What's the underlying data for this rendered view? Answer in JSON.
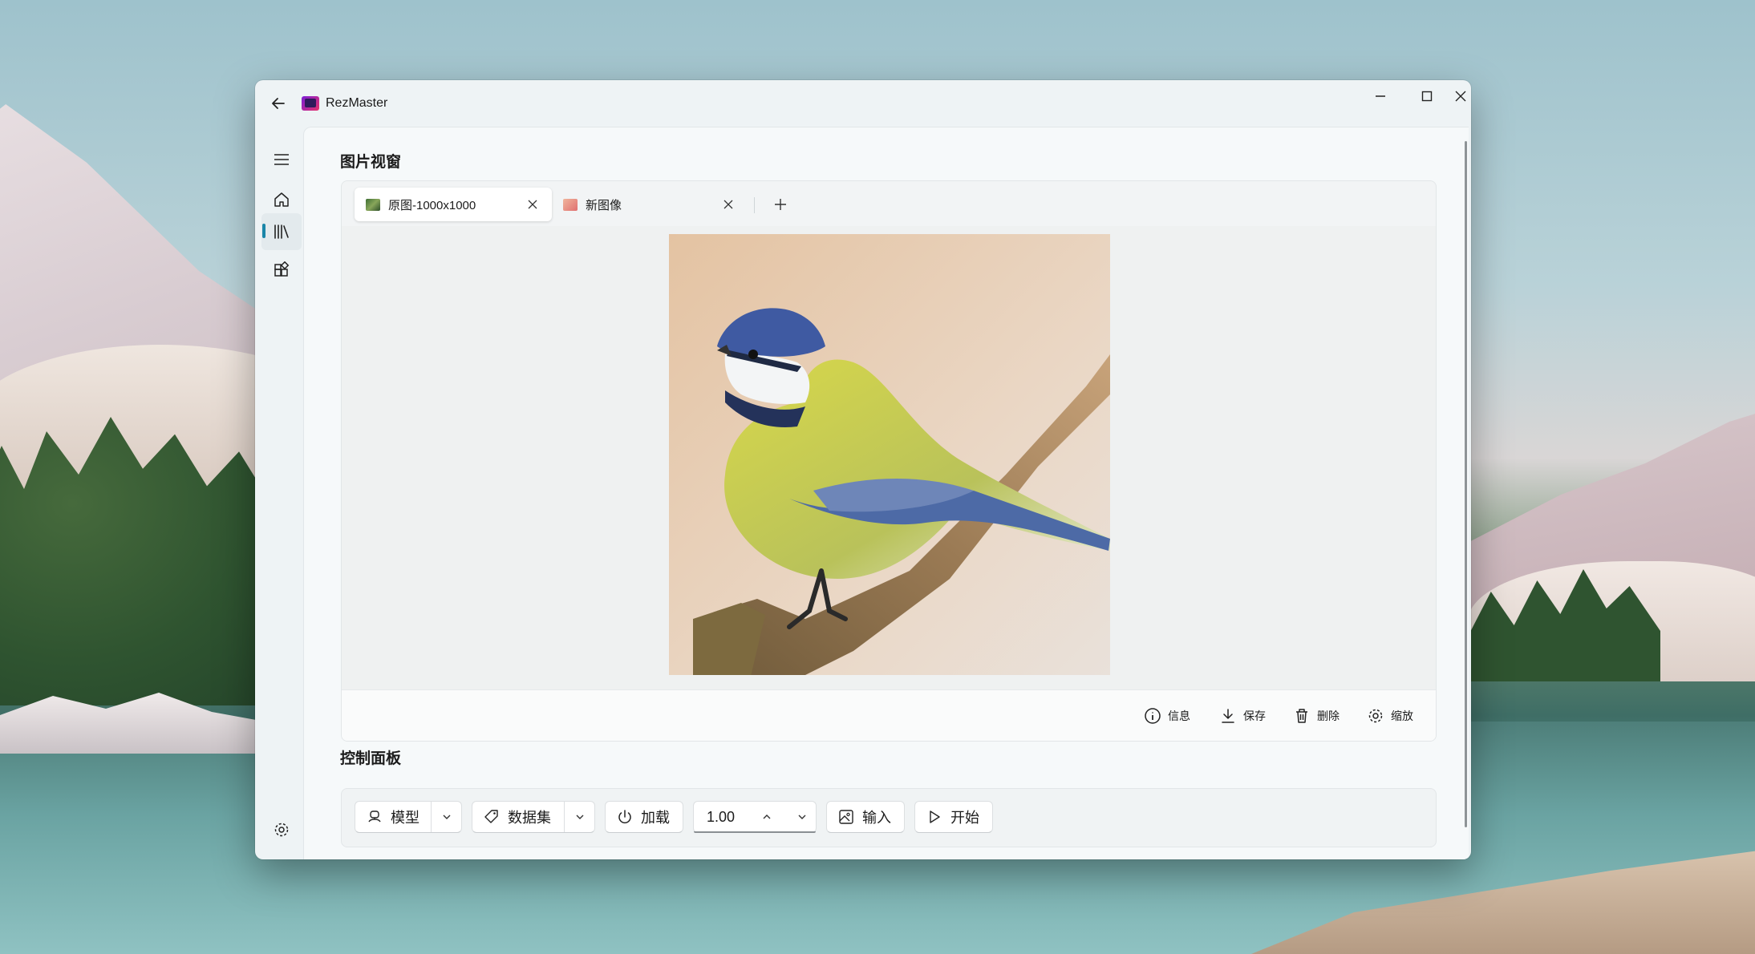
{
  "app": {
    "title": "RezMaster"
  },
  "window_controls": {
    "minimize": "minimize-icon",
    "maximize": "maximize-icon",
    "close": "close-icon"
  },
  "nav": {
    "items": [
      {
        "id": "menu",
        "icon": "hamburger-icon"
      },
      {
        "id": "home",
        "icon": "home-icon"
      },
      {
        "id": "library",
        "icon": "library-icon",
        "active": true
      },
      {
        "id": "extensions",
        "icon": "apps-icon"
      }
    ],
    "footer": {
      "icon": "settings-icon"
    }
  },
  "image_view": {
    "section_title": "图片视窗",
    "tabs": [
      {
        "label": "原图-1000x1000",
        "active": true
      },
      {
        "label": "新图像",
        "active": false
      }
    ],
    "toolbar": {
      "info": "信息",
      "save": "保存",
      "delete": "删除",
      "zoom": "缩放"
    }
  },
  "control_panel": {
    "section_title": "控制面板",
    "model_label": "模型",
    "dataset_label": "数据集",
    "load_label": "加载",
    "scale_value": "1.00",
    "input_label": "输入",
    "start_label": "开始"
  },
  "colors": {
    "accent": "#1a86a8",
    "window_bg": "#eef3f5",
    "content_bg": "#f6f9fa"
  }
}
